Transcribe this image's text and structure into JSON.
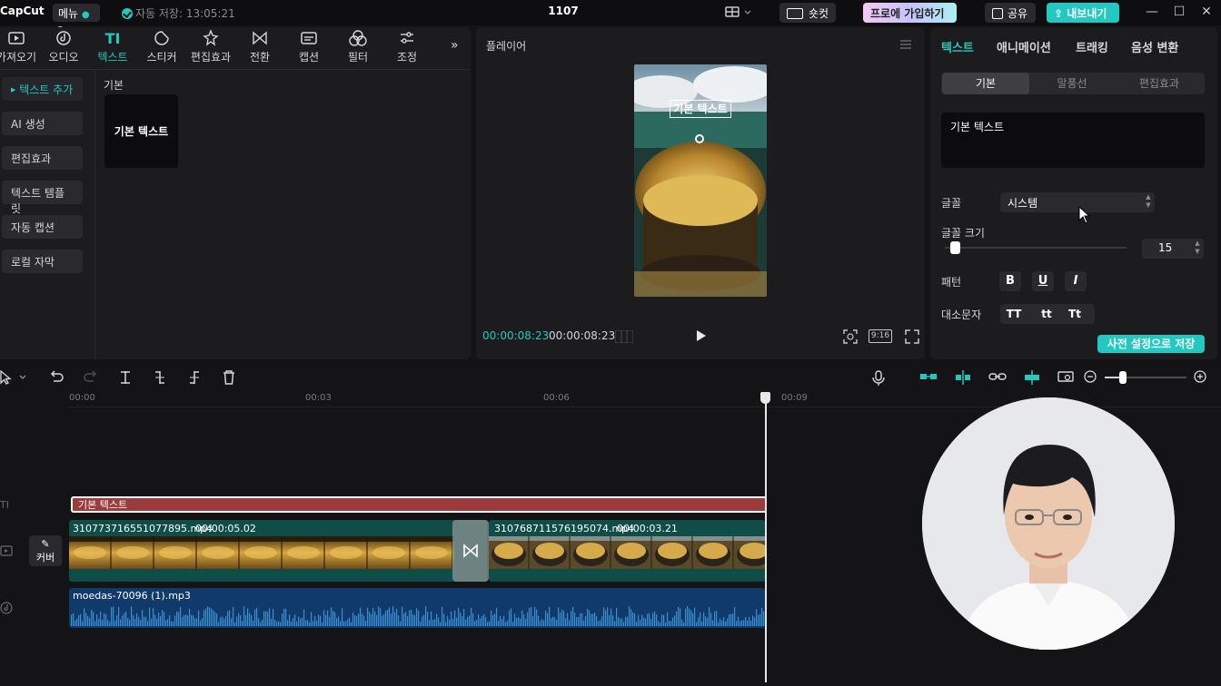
{
  "titlebar": {
    "logo": "CapCut",
    "menu_label": "메뉴",
    "autosave": "자동 저장: 13:05:21",
    "project_title": "1107",
    "shortcut_label": "숏컷",
    "pro_label": "프로에 가입하기",
    "share_label": "공유",
    "export_label": "내보내기"
  },
  "tools": [
    {
      "label": "가져오기",
      "icon": "import-icon"
    },
    {
      "label": "오디오",
      "icon": "audio-icon"
    },
    {
      "label": "텍스트",
      "icon": "text-icon"
    },
    {
      "label": "스티커",
      "icon": "sticker-icon"
    },
    {
      "label": "편집효과",
      "icon": "effects-icon"
    },
    {
      "label": "전환",
      "icon": "transition-icon"
    },
    {
      "label": "캡션",
      "icon": "caption-icon"
    },
    {
      "label": "필터",
      "icon": "filter-icon"
    },
    {
      "label": "조정",
      "icon": "adjust-icon"
    }
  ],
  "sidebar": {
    "items": [
      {
        "label": "텍스트 추가"
      },
      {
        "label": "AI 생성"
      },
      {
        "label": "편집효과"
      },
      {
        "label": "텍스트 템플릿"
      },
      {
        "label": "자동 캡션"
      },
      {
        "label": "로컬 자막"
      }
    ]
  },
  "library": {
    "section": "기본",
    "card_label": "기본 텍스트"
  },
  "player": {
    "title": "플레이어",
    "overlay_text": "기본 텍스트",
    "current_time": "00:00:08:23",
    "total_time": "00:00:08:23",
    "ratio": "9:16"
  },
  "inspector": {
    "tabs": [
      "텍스트",
      "애니메이션",
      "트래킹",
      "음성 변환"
    ],
    "subtabs": [
      "기본",
      "말풍선",
      "편집효과"
    ],
    "text_value": "기본 텍스트",
    "font_label": "글꼴",
    "font_value": "시스템",
    "size_label": "글꼴 크기",
    "size_value": "15",
    "size_fraction": 0.03,
    "pattern_label": "패턴",
    "pattern_buttons": [
      "B",
      "U",
      "I"
    ],
    "case_label": "대소문자",
    "case_buttons": [
      "TT",
      "tt",
      "Tt"
    ],
    "preset_label": "사전 설정으로 저장"
  },
  "timeline": {
    "ruler": [
      "00:00",
      "00:03",
      "00:06",
      "00:09"
    ],
    "text_clip": "기본 텍스트",
    "video_clips": [
      {
        "name": "310773716551077895.mp4",
        "duration": "00:00:05.02"
      },
      {
        "name": "310768711576195074.mp4",
        "duration": "00:00:03.21"
      }
    ],
    "audio_clip": "moedas-70096 (1).mp3",
    "cover_label": "커버"
  },
  "colors": {
    "accent": "#22c9c0",
    "text_clip": "#9b3b3b",
    "video_clip": "#0f4e48",
    "audio_clip": "#0f3a6a"
  }
}
